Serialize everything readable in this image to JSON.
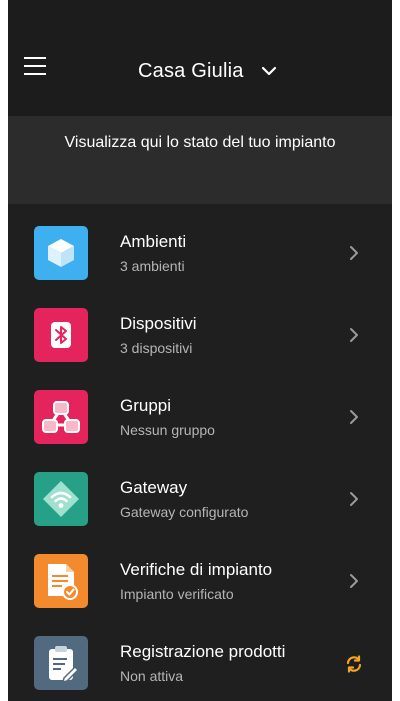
{
  "header": {
    "home_name": "Casa Giulia",
    "menu_icon": "hamburger-menu-icon",
    "dropdown_icon": "chevron-down-icon"
  },
  "banner": {
    "text": "Visualizza qui lo stato del tuo impianto"
  },
  "items": [
    {
      "title": "Ambienti",
      "subtitle": "3 ambienti",
      "icon": "cube-icon",
      "color": "#3fb0ef",
      "action_icon": "chevron-right-icon"
    },
    {
      "title": "Dispositivi",
      "subtitle": "3 dispositivi",
      "icon": "bluetooth-icon",
      "color": "#e5235c",
      "action_icon": "chevron-right-icon"
    },
    {
      "title": "Gruppi",
      "subtitle": "Nessun gruppo",
      "icon": "group-icon",
      "color": "#e5235c",
      "action_icon": "chevron-right-icon"
    },
    {
      "title": "Gateway",
      "subtitle": "Gateway configurato",
      "icon": "wifi-gateway-icon",
      "color": "#26a087",
      "action_icon": "chevron-right-icon"
    },
    {
      "title": "Verifiche di impianto",
      "subtitle": "Impianto verificato",
      "icon": "verified-document-icon",
      "color": "#f38a2d",
      "action_icon": "chevron-right-icon"
    },
    {
      "title": "Registrazione prodotti",
      "subtitle": "Non attiva",
      "icon": "clipboard-icon",
      "color": "#516a7f",
      "action_icon": "sync-icon"
    }
  ],
  "colors": {
    "background": "#1f1f1f",
    "header": "#1c1c1c",
    "banner": "#2c2c2c",
    "accent_sync": "#f5a524"
  }
}
